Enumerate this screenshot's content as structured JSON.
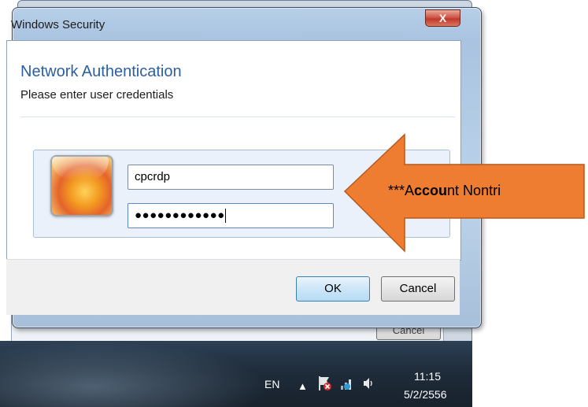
{
  "dialog": {
    "title": "Windows Security",
    "close_label": "X",
    "heading": "Network Authentication",
    "subtitle": "Please enter user credentials",
    "username_value": "cpcrdp",
    "password_value": "●●●●●●●●●●●●",
    "ok_label": "OK",
    "cancel_label": "Cancel"
  },
  "background_window": {
    "cancel_label": "Cancel"
  },
  "annotation": {
    "prefix": "***A",
    "bold": "ccou",
    "suffix": "nt Nontri",
    "arrow_color": "#ee7d31"
  },
  "taskbar": {
    "language": "EN",
    "show_hidden_icon": "▲",
    "time": "11:15",
    "date": "5/2/2556"
  }
}
